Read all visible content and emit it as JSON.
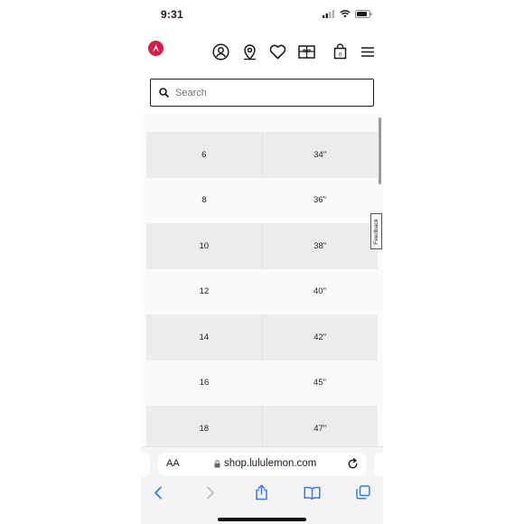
{
  "status_bar": {
    "time": "9:31"
  },
  "header": {
    "logo": "lululemon-logo-icon",
    "bag_count": "0",
    "icons": [
      "account-icon",
      "store-locator-icon",
      "wishlist-heart-icon",
      "gift-card-icon",
      "shopping-bag-icon",
      "menu-icon"
    ]
  },
  "search": {
    "placeholder": "Search",
    "value": ""
  },
  "size_table": {
    "rows": [
      {
        "size": "6",
        "measure": "34\""
      },
      {
        "size": "8",
        "measure": "36\""
      },
      {
        "size": "10",
        "measure": "38\""
      },
      {
        "size": "12",
        "measure": "40\""
      },
      {
        "size": "14",
        "measure": "42\""
      },
      {
        "size": "16",
        "measure": "45\""
      },
      {
        "size": "18",
        "measure": "47\""
      }
    ]
  },
  "feedback": {
    "label": "Feedback"
  },
  "browser": {
    "text_size_label": "AA",
    "url": "shop.lululemon.com",
    "toolbar": [
      "back-icon",
      "forward-icon",
      "share-icon",
      "bookmarks-icon",
      "tabs-icon"
    ]
  },
  "colors": {
    "brand_red": "#d31e47",
    "text": "#1a1a1a",
    "row_shade": "#ececec"
  }
}
